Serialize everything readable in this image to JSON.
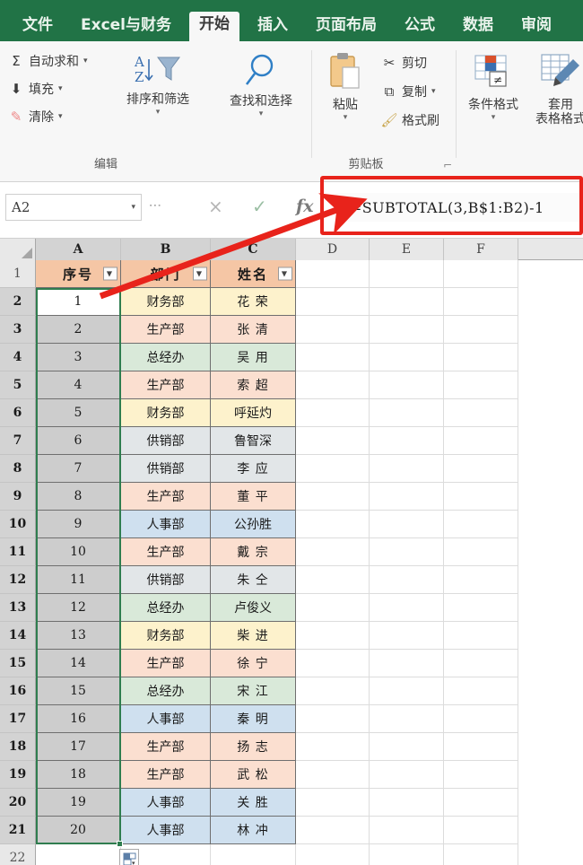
{
  "ribbon": {
    "tabs": [
      {
        "label": "文件",
        "active": false
      },
      {
        "label": "Excel与财务",
        "active": false
      },
      {
        "label": "开始",
        "active": true
      },
      {
        "label": "插入",
        "active": false
      },
      {
        "label": "页面布局",
        "active": false
      },
      {
        "label": "公式",
        "active": false
      },
      {
        "label": "数据",
        "active": false
      },
      {
        "label": "审阅",
        "active": false
      }
    ],
    "groups": {
      "editing": {
        "title": "编辑",
        "autosum": "自动求和",
        "fill": "填充",
        "clear": "清除",
        "sort_filter": "排序和筛选",
        "find_select": "查找和选择"
      },
      "clipboard": {
        "title": "剪贴板",
        "paste": "粘贴",
        "cut": "剪切",
        "copy": "复制",
        "format_painter": "格式刷"
      },
      "styles": {
        "conditional_formatting": "条件格式",
        "format_as_table_line1": "套用",
        "format_as_table_line2": "表格格式"
      }
    }
  },
  "formula_bar": {
    "name_box_value": "A2",
    "cancel_icon": "×",
    "confirm_icon": "✓",
    "fx_label": "fx",
    "formula": "=SUBTOTAL(3,B$1:B2)-1"
  },
  "grid": {
    "column_headers": [
      "A",
      "B",
      "C",
      "D",
      "E",
      "F"
    ],
    "row_numbers": [
      1,
      2,
      3,
      4,
      5,
      6,
      7,
      8,
      9,
      10,
      11,
      12,
      13,
      14,
      15,
      16,
      17,
      18,
      19,
      20,
      21,
      22
    ],
    "table_headers": [
      "序号",
      "部门",
      "姓名"
    ],
    "rows": [
      {
        "seq": "1",
        "dept": "财务部",
        "name": "花  荣"
      },
      {
        "seq": "2",
        "dept": "生产部",
        "name": "张  清"
      },
      {
        "seq": "3",
        "dept": "总经办",
        "name": "吴  用"
      },
      {
        "seq": "4",
        "dept": "生产部",
        "name": "索  超"
      },
      {
        "seq": "5",
        "dept": "财务部",
        "name": "呼延灼"
      },
      {
        "seq": "6",
        "dept": "供销部",
        "name": "鲁智深"
      },
      {
        "seq": "7",
        "dept": "供销部",
        "name": "李  应"
      },
      {
        "seq": "8",
        "dept": "生产部",
        "name": "董  平"
      },
      {
        "seq": "9",
        "dept": "人事部",
        "name": "公孙胜"
      },
      {
        "seq": "10",
        "dept": "生产部",
        "name": "戴  宗"
      },
      {
        "seq": "11",
        "dept": "供销部",
        "name": "朱  仝"
      },
      {
        "seq": "12",
        "dept": "总经办",
        "name": "卢俊义"
      },
      {
        "seq": "13",
        "dept": "财务部",
        "name": "柴  进"
      },
      {
        "seq": "14",
        "dept": "生产部",
        "name": "徐  宁"
      },
      {
        "seq": "15",
        "dept": "总经办",
        "name": "宋  江"
      },
      {
        "seq": "16",
        "dept": "人事部",
        "name": "秦  明"
      },
      {
        "seq": "17",
        "dept": "生产部",
        "name": "扬  志"
      },
      {
        "seq": "18",
        "dept": "生产部",
        "name": "武  松"
      },
      {
        "seq": "19",
        "dept": "人事部",
        "name": "关  胜"
      },
      {
        "seq": "20",
        "dept": "人事部",
        "name": "林  冲"
      }
    ],
    "active_cell": "A2",
    "selection": "A2:A21"
  },
  "colors": {
    "ribbon_green": "#217346",
    "callout_red": "#e8231b",
    "selection_green": "#2f7d4f",
    "header_orange": "#f5c6a5",
    "dept_财务部": "#fdf2cc",
    "dept_生产部": "#fbdfd0",
    "dept_总经办": "#d9e9d9",
    "dept_供销部": "#e2e6e8",
    "dept_人事部": "#cfe0ef",
    "selected_cell_gray": "#cdcdcd"
  }
}
